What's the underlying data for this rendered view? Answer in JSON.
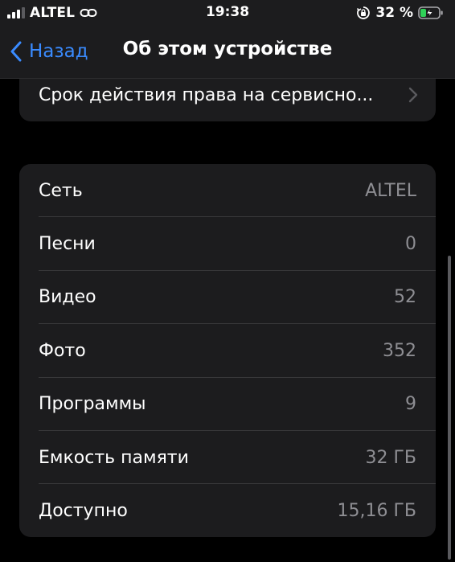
{
  "status_bar": {
    "carrier": "ALTEL",
    "time": "19:38",
    "battery_percent": "32 %",
    "signal_bars_active": 3,
    "signal_bars_total": 4,
    "battery_level": 0.32,
    "battery_color": "#30d158"
  },
  "nav": {
    "back_label": "Назад",
    "title": "Об этом устройстве",
    "accent_color": "#3a8bff"
  },
  "top_card": {
    "label": "Срок действия права на сервисно..."
  },
  "info_rows": [
    {
      "label": "Сеть",
      "value": "ALTEL"
    },
    {
      "label": "Песни",
      "value": "0"
    },
    {
      "label": "Видео",
      "value": "52"
    },
    {
      "label": "Фото",
      "value": "352"
    },
    {
      "label": "Программы",
      "value": "9"
    },
    {
      "label": "Емкость памяти",
      "value": "32 ГБ"
    },
    {
      "label": "Доступно",
      "value": "15,16 ГБ"
    }
  ],
  "icons": {
    "signal": "cellular-signal-icon",
    "link": "personal-hotspot-link-icon",
    "rotation_lock": "orientation-lock-icon",
    "battery": "battery-charging-icon",
    "back": "chevron-left-icon",
    "disclosure": "chevron-right-icon"
  }
}
